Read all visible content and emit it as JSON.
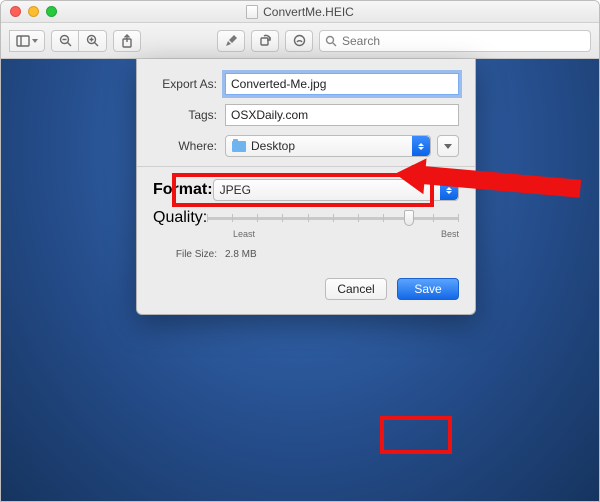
{
  "window": {
    "title": "ConvertMe.HEIC"
  },
  "toolbar": {
    "search_placeholder": "Search"
  },
  "sheet": {
    "exportAs": {
      "label": "Export As:",
      "value": "Converted-Me.jpg"
    },
    "tags": {
      "label": "Tags:",
      "value": "OSXDaily.com"
    },
    "where": {
      "label": "Where:",
      "value": "Desktop"
    },
    "format": {
      "label": "Format:",
      "value": "JPEG"
    },
    "quality": {
      "label": "Quality:",
      "min_label": "Least",
      "max_label": "Best",
      "value_percent": 80
    },
    "fileSize": {
      "label": "File Size:",
      "value": "2.8 MB"
    },
    "actions": {
      "cancel": "Cancel",
      "save": "Save"
    }
  },
  "highlight_color": "#e11"
}
